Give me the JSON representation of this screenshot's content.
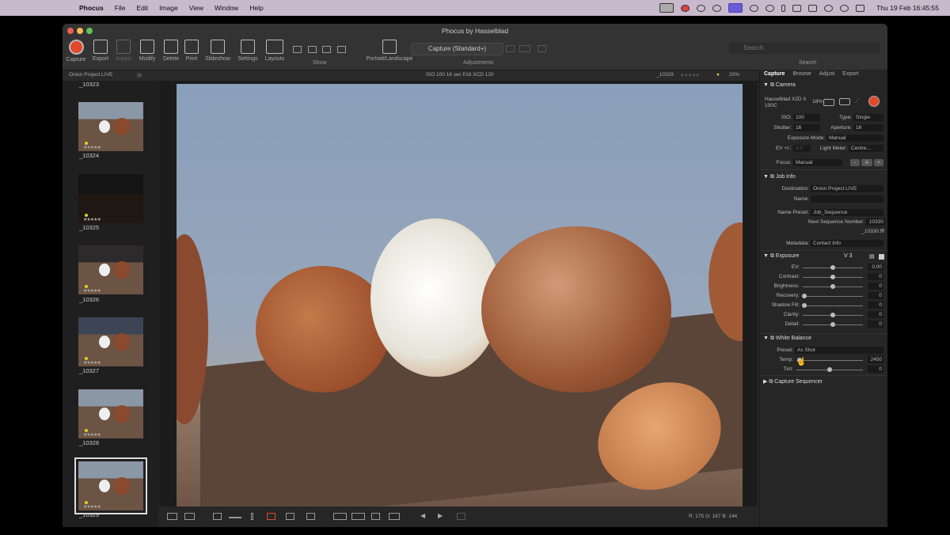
{
  "menubar": {
    "app": "Phocus",
    "items": [
      "File",
      "Edit",
      "Image",
      "View",
      "Window",
      "Help"
    ],
    "clock": "Thu 19 Feb  16:45:55"
  },
  "window": {
    "title": "Phocus by Hasselblad"
  },
  "toolbar": {
    "capture": "Capture",
    "export": "Export",
    "import": "Import",
    "modify": "Modify",
    "delete": "Delete",
    "print": "Print",
    "slideshow": "Slideshow",
    "settings": "Settings",
    "layouts": "Layouts",
    "show": "Show",
    "portrait_landscape": "Portrait/Landscape",
    "adjustments_label": "Adjustments",
    "adjustments_value": "Capture (Standard+)",
    "search_placeholder": "Search",
    "search_label": "Search"
  },
  "infobar": {
    "folder": "Onion Project LIVE",
    "shot_info": "ISO 100   16 sec  f/16   XCD 120",
    "image_name": "_10329",
    "zoom": "20%"
  },
  "thumbnails": [
    "_10323",
    "_10324",
    "_10325",
    "_10326",
    "_10327",
    "_10328",
    "_10329"
  ],
  "status": {
    "rgb": "R: 175  G: 167  B: 144"
  },
  "panel": {
    "tabs": [
      "Capture",
      "Browse",
      "Adjust",
      "Export"
    ],
    "camera": {
      "title": "Camera",
      "model": "Hasselblad X2D II 100C",
      "battery": "18%",
      "iso_label": "ISO:",
      "iso": "100",
      "type_label": "Type:",
      "type": "Single",
      "shutter_label": "Shutter:",
      "shutter": "16",
      "aperture_label": "Aperture:",
      "aperture": "16",
      "exposure_mode_label": "Exposure Mode:",
      "exposure_mode": "Manual",
      "ev_label": "EV +/-:",
      "ev": "0.0",
      "light_meter_label": "Light Meter:",
      "light_meter": "Centre...",
      "focus_label": "Focus:",
      "focus": "Manual",
      "af_minus": "-",
      "af": "A",
      "af_plus": "+"
    },
    "job_info": {
      "title": "Job Info",
      "destination_label": "Destination:",
      "destination": "Onion Project LIVE",
      "name_label": "Name:",
      "name_preset_label": "Name Preset:",
      "name_preset": "Job_Sequence",
      "next_seq_label": "Next Sequence Number:",
      "next_seq": "10330",
      "next_file": "_10330.fff",
      "metadata_label": "Metadata:",
      "metadata": "Contact Info"
    },
    "exposure": {
      "title": "Exposure",
      "version": "V 3",
      "sliders": [
        {
          "label": "EV:",
          "value": "0,00",
          "level": 0.5
        },
        {
          "label": "Contrast:",
          "value": "0",
          "level": 0.5
        },
        {
          "label": "Brightness:",
          "value": "0",
          "level": 0.5
        },
        {
          "label": "Recovery:",
          "value": "0",
          "level": 0.02
        },
        {
          "label": "Shadow Fill:",
          "value": "0",
          "level": 0.02
        },
        {
          "label": "Clarity:",
          "value": "0",
          "level": 0.5
        },
        {
          "label": "Detail:",
          "value": "0",
          "level": 0.5
        }
      ]
    },
    "white_balance": {
      "title": "White Balance",
      "preset_label": "Preset:",
      "preset": "As Shot",
      "temp_label": "Temp:",
      "temp": "2450",
      "temp_level": 0.05,
      "tint_label": "Tint:",
      "tint": "0",
      "tint_level": 0.5
    },
    "capture_sequencer": {
      "title": "Capture Sequencer"
    }
  }
}
